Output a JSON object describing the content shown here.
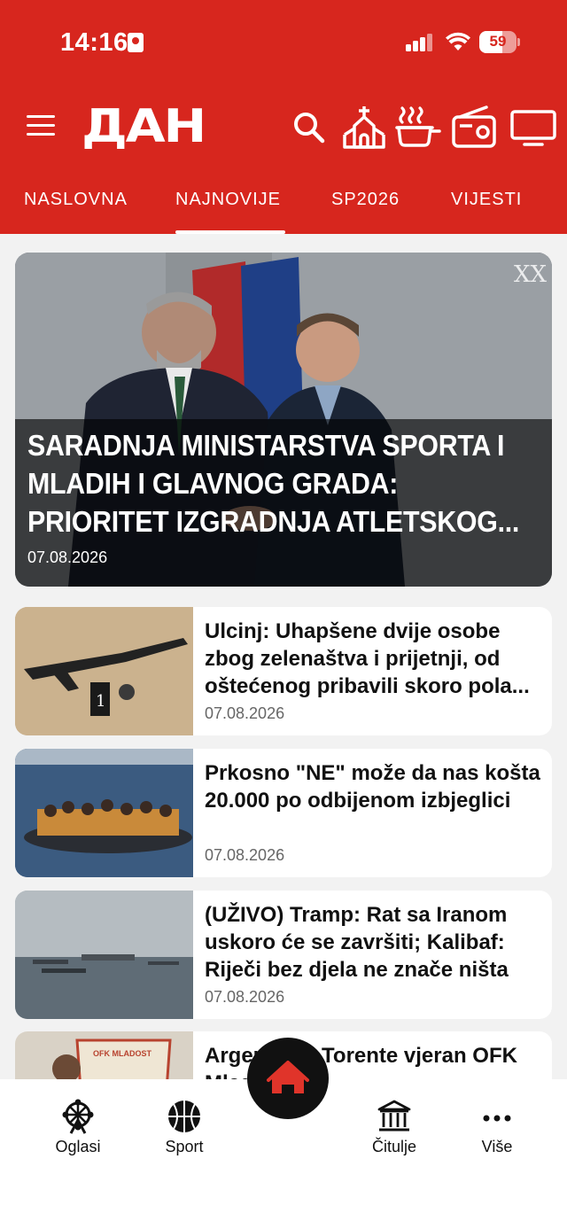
{
  "status_bar": {
    "time": "14:16",
    "battery": "59"
  },
  "app": {
    "logo": "ДАН"
  },
  "toolbar": {
    "icons": [
      "menu-icon",
      "search-icon",
      "church-icon",
      "cooking-pot-icon",
      "radio-icon",
      "tv-icon"
    ]
  },
  "tabs": [
    {
      "label": "NASLOVNA"
    },
    {
      "label": "NAJNOVIJE",
      "active": true
    },
    {
      "label": "SP2026"
    },
    {
      "label": "VIJESTI"
    }
  ],
  "featured": {
    "title": "SARADNJA MINISTARSTVA SPORTA I MLADIH I GLAVNOG GRADA: PRIORITET IZGRADNJA ATLETSKOG...",
    "date": "07.08.2026",
    "watermark": "XX"
  },
  "articles": [
    {
      "title": "Ulcinj: Uhapšene dvije osobe zbog zelenaštva i prijetnji, od oštećenog pribavili skoro pola...",
      "date": "07.08.2026",
      "thumb_label": "1"
    },
    {
      "title": "Prkosno \"NE\" može da nas košta 20.000 po odbijenom izbjeglici",
      "date": "07.08.2026"
    },
    {
      "title": "(UŽIVO) Tramp: Rat sa Iranom uskoro će se završiti; Kalibaf: Riječi bez djela ne znače ništa",
      "date": "07.08.2026"
    },
    {
      "title": "Argentinac Torente vjeran OFK Mladosti",
      "date": "",
      "thumb_label": "OFK MLADOST"
    }
  ],
  "bottom_nav": [
    {
      "label": "Oglasi",
      "icon": "ferris-wheel-icon"
    },
    {
      "label": "Sport",
      "icon": "basketball-icon"
    },
    {
      "label": "",
      "icon": "home-icon"
    },
    {
      "label": "Čitulje",
      "icon": "building-columns-icon"
    },
    {
      "label": "Više",
      "icon": "more-icon"
    }
  ],
  "colors": {
    "brand_red": "#d7261e",
    "home_button": "#111111",
    "home_icon": "#e0342a"
  }
}
